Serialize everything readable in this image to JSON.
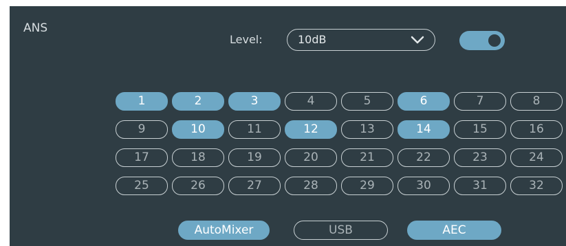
{
  "panel": {
    "title": "ANS",
    "level_label": "Level:",
    "level_value": "10dB",
    "toggle_enabled": true
  },
  "channels": [
    {
      "label": "1",
      "on": true
    },
    {
      "label": "2",
      "on": true
    },
    {
      "label": "3",
      "on": true
    },
    {
      "label": "4",
      "on": false
    },
    {
      "label": "5",
      "on": false
    },
    {
      "label": "6",
      "on": true
    },
    {
      "label": "7",
      "on": false
    },
    {
      "label": "8",
      "on": false
    },
    {
      "label": "9",
      "on": false
    },
    {
      "label": "10",
      "on": true
    },
    {
      "label": "11",
      "on": false
    },
    {
      "label": "12",
      "on": true
    },
    {
      "label": "13",
      "on": false
    },
    {
      "label": "14",
      "on": true
    },
    {
      "label": "15",
      "on": false
    },
    {
      "label": "16",
      "on": false
    },
    {
      "label": "17",
      "on": false
    },
    {
      "label": "18",
      "on": false
    },
    {
      "label": "19",
      "on": false
    },
    {
      "label": "20",
      "on": false
    },
    {
      "label": "21",
      "on": false
    },
    {
      "label": "22",
      "on": false
    },
    {
      "label": "23",
      "on": false
    },
    {
      "label": "24",
      "on": false
    },
    {
      "label": "25",
      "on": false
    },
    {
      "label": "26",
      "on": false
    },
    {
      "label": "27",
      "on": false
    },
    {
      "label": "28",
      "on": false
    },
    {
      "label": "29",
      "on": false
    },
    {
      "label": "30",
      "on": false
    },
    {
      "label": "31",
      "on": false
    },
    {
      "label": "32",
      "on": false
    }
  ],
  "bottom_buttons": [
    {
      "label": "AutoMixer",
      "on": true
    },
    {
      "label": "USB",
      "on": false
    },
    {
      "label": "AEC",
      "on": true
    }
  ],
  "colors": {
    "panel_bg": "#2f3d44",
    "accent": "#6ea8c5",
    "outline": "#c9d1d4"
  }
}
